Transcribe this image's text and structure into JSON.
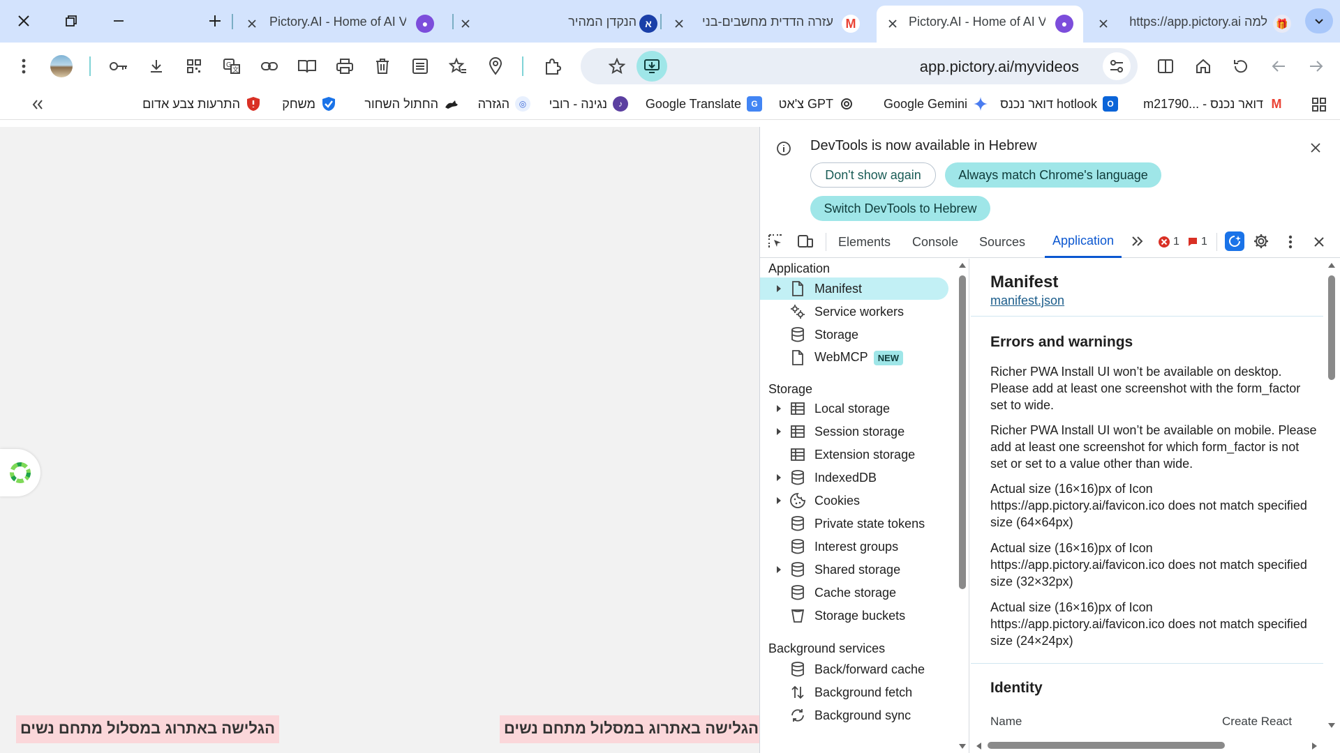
{
  "window": {
    "close_label": "✕",
    "restore_label": "❐",
    "minimize_label": "—",
    "newtab_label": "+"
  },
  "tabs": [
    {
      "title": "Pictory.AI - Home of AI V",
      "favicon": "pictory-octopus",
      "active": false
    },
    {
      "title": "הנקדן המהיר",
      "favicon": "nakdan-a",
      "active": false
    },
    {
      "title": "עזרה הדדית מחשבים-בני",
      "favicon": "gmail-0",
      "active": false
    },
    {
      "title": "Pictory.AI - Home of AI V",
      "favicon": "pictory-octopus",
      "active": true
    },
    {
      "title": "למה https://app.pictory.ai",
      "favicon": "gift",
      "active": false
    }
  ],
  "toolbar": {
    "url": "app.pictory.ai/myvideos"
  },
  "bookmarks": [
    {
      "label": "m21790... - דואר נכנס",
      "icon": "gmail",
      "color": "#ea4335"
    },
    {
      "label": "דואר נכנס hotlook",
      "icon": "outlook",
      "color": "#0a64d8"
    },
    {
      "label": "Google Gemini",
      "icon": "gemini",
      "color": "#4285f4"
    },
    {
      "label": "צ'אט GPT",
      "icon": "openai",
      "color": "#333333"
    },
    {
      "label": "Google Translate",
      "icon": "translate",
      "color": "#4285f4"
    },
    {
      "label": "נגינה - רובי",
      "icon": "music",
      "color": "#5b3fa0"
    },
    {
      "label": "הגזרה",
      "icon": "news",
      "color": "#3967d6"
    },
    {
      "label": "החתול השחור",
      "icon": "cat",
      "color": "#222222"
    },
    {
      "label": "משחק",
      "icon": "shield-check",
      "color": "#1a73e8"
    },
    {
      "label": "התרעות צבע אדום",
      "icon": "shield-red",
      "color": "#d93025"
    }
  ],
  "page": {
    "banner_text": "הגלישה באתרוג במסלול מתחם נשים"
  },
  "devtools": {
    "infobar": {
      "message": "DevTools is now available in Hebrew",
      "btn_dont_show": "Don't show again",
      "btn_match": "Always match Chrome's language",
      "btn_switch": "Switch DevTools to Hebrew"
    },
    "tabs": {
      "elements": "Elements",
      "console": "Console",
      "sources": "Sources",
      "application": "Application",
      "errors_count": "1",
      "issues_count": "1"
    },
    "sidebar": {
      "application_header": "Application",
      "manifest": "Manifest",
      "service_workers": "Service workers",
      "storage": "Storage",
      "webmcp": "WebMCP",
      "new_badge": "NEW",
      "storage_header": "Storage",
      "local_storage": "Local storage",
      "session_storage": "Session storage",
      "extension_storage": "Extension storage",
      "indexeddb": "IndexedDB",
      "cookies": "Cookies",
      "private_state_tokens": "Private state tokens",
      "interest_groups": "Interest groups",
      "shared_storage": "Shared storage",
      "cache_storage": "Cache storage",
      "storage_buckets": "Storage buckets",
      "background_header": "Background services",
      "bf_cache": "Back/forward cache",
      "bg_fetch": "Background fetch",
      "bg_sync": "Background sync"
    },
    "main": {
      "title": "Manifest",
      "link": "manifest.json",
      "errors_title": "Errors and warnings",
      "errors": [
        "Richer PWA Install UI won’t be available on desktop. Please add at least one screenshot with the form_factor set to wide.",
        "Richer PWA Install UI won’t be available on mobile. Please add at least one screenshot for which form_factor is not set or set to a value other than wide.",
        "Actual size (16×16)px of Icon https://app.pictory.ai/favicon.ico does not match specified size (64×64px)",
        "Actual size (16×16)px of Icon https://app.pictory.ai/favicon.ico does not match specified size (32×32px)",
        "Actual size (16×16)px of Icon https://app.pictory.ai/favicon.ico does not match specified size (24×24px)"
      ],
      "identity_title": "Identity",
      "name_label": "Name",
      "name_value": "Create React"
    }
  },
  "colors": {
    "tabstrip": "#d3e3fd",
    "accent": "#0b57d0",
    "devtools_pill": "#9fe6e8",
    "banner": "#fbd7da"
  }
}
